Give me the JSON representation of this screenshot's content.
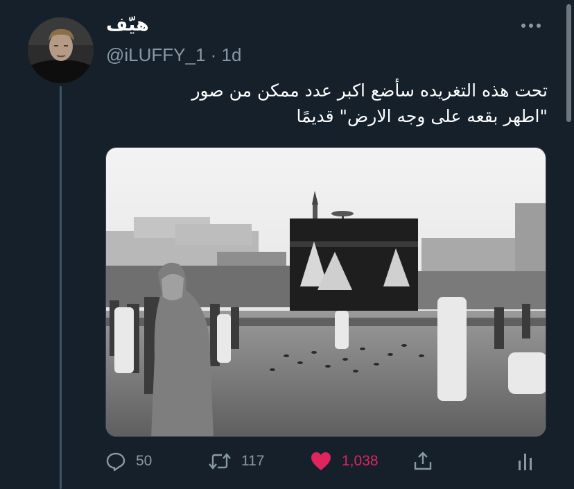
{
  "author": {
    "display_name": "هيّف",
    "handle_line": "@iLUFFY_1 · 1d"
  },
  "tweet": {
    "text_line1": "تحت هذه التغريده سأضع اكبر عدد ممكن من صور",
    "text_line2": "\"اطهر بقعه على وجه الارض\" قديمًا"
  },
  "actions": {
    "reply_count": "50",
    "retweet_count": "117",
    "like_count": "1,038"
  },
  "colors": {
    "background": "#15202b",
    "secondary_text": "#8899a6",
    "like": "#e0245e"
  },
  "icons": [
    "more-icon",
    "reply-icon",
    "retweet-icon",
    "like-icon",
    "share-icon",
    "analytics-icon"
  ]
}
